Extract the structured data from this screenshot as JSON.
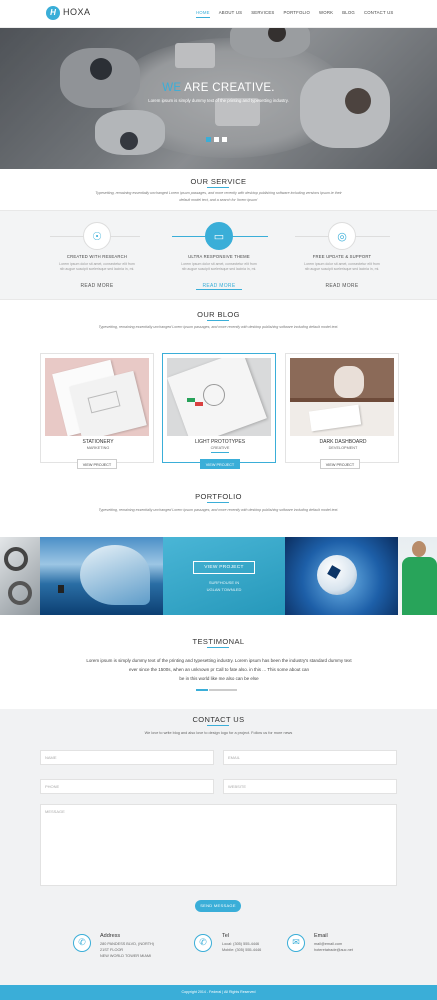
{
  "header": {
    "logo_letter": "H",
    "logo_text": "HOXA",
    "nav": [
      "HOME",
      "ABOUT US",
      "SERVICES",
      "PORTFOLIO",
      "WORK",
      "BLOG",
      "CONTACT US"
    ]
  },
  "hero": {
    "title_highlight": "WE",
    "title_rest": " ARE CREATIVE.",
    "subtitle": "Lorem ipsum is simply dummy text of the printing and typesetting industry.",
    "slides": 3,
    "active_slide": 0
  },
  "service": {
    "title": "OUR SERVICE",
    "desc": "Typesetting, remaining essentially unchanged Lorem ipsum passages, and more recently with desktop publishing software including versions Ipsum.ie their default model text, and a search for 'lorem ipsum'",
    "items": [
      {
        "icon": "bulb-icon",
        "glyph": "☉",
        "title": "CREATED WITH RESEARCH",
        "desc": "Lorem ipsum dolor sit amet, consectetur elit from nib augue suscipit scelerisque sed lacinia in, mi.",
        "more": "READ MORE"
      },
      {
        "icon": "monitor-icon",
        "glyph": "▭",
        "title": "ULTRA RESPONSIVE THEME",
        "desc": "Lorem ipsum dolor sit amet, consectetur elit from nib augue suscipit scelerisque sed lacinia in, mi.",
        "more": "READ MORE"
      },
      {
        "icon": "target-icon",
        "glyph": "◎",
        "title": "FREE UPDATE & SUPPORT",
        "desc": "Lorem ipsum dolor sit amet, consectetur elit from nib augue suscipit scelerisque sed lacinia in, mi.",
        "more": "READ MORE"
      }
    ]
  },
  "blog": {
    "title": "OUR BLOG",
    "desc": "Typesetting, remaining essentially unchanged Lorem ipsum passages, and more recently with desktop publishing software including default model text.",
    "cards": [
      {
        "title": "STATIONERY",
        "category": "MARKETING",
        "button": "VIEW PROJECT"
      },
      {
        "title": "LIGHT PROTOTYPES",
        "category": "CREATIVE",
        "button": "VIEW PROJECT"
      },
      {
        "title": "DARK DASHBOARD",
        "category": "DEVELOPMENT",
        "button": "VIEW PROJECT"
      }
    ]
  },
  "portfolio": {
    "title": "PORTFOLIO",
    "desc": "Typesetting, remaining essentially unchanged Lorem ipsum passages, and more recently with desktop publishing software including default model text.",
    "overlay_button": "VIEW PROJECT",
    "overlay_line1": "SURFHOUSE IN",
    "overlay_line2": "UGLAN TOWNLED"
  },
  "testimonial": {
    "title": "TESTIMONAL",
    "text_lines": [
      "Lorem ipsum is simply dummy text of the printing and typesetting industry. Lorem ipsum has been the industry's standard dummy text",
      "ever since the 1500s, when an unknown pr Call to fate also. in this ... This some about can",
      "be in this world like me also can be else"
    ]
  },
  "contact": {
    "title": "CONTACT US",
    "desc": "We love to write blog and also love to design logo for a project. Follow us for more news",
    "fields": {
      "name": "NAME",
      "email": "EMAIL",
      "phone": "PHONE",
      "website": "WEBSITE",
      "message": "MESSAGE"
    },
    "send_label": "SEND MESSAGE",
    "info": [
      {
        "icon": "phone-icon",
        "title": "Address",
        "lines": [
          "280 PANDESS BLVD, (NORTH)",
          "21ST FLOOR",
          "NEW WORLD TOWER MIAMI"
        ]
      },
      {
        "icon": "phone-icon",
        "title": "Tel",
        "lines": [
          "Local: (305) 555-4446",
          "Mobile: (305) 555-4446"
        ]
      },
      {
        "icon": "email-icon",
        "title": "Email",
        "lines": [
          "mail@email.com",
          "hoteretatrade@auc.net"
        ]
      }
    ]
  },
  "footer": {
    "text": "Copyright 2014 - Federal | All Rights Reserved"
  },
  "colors": {
    "accent": "#3aaed8",
    "band": "#f3f4f5"
  }
}
